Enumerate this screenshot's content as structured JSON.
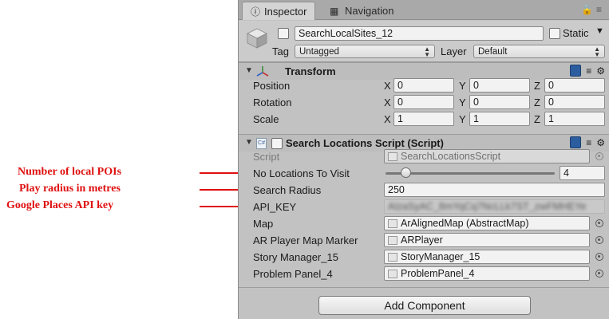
{
  "annotations": [
    {
      "label": "Number of local POIs"
    },
    {
      "label": "Play radius in metres"
    },
    {
      "label": "Google Places API key"
    }
  ],
  "tabs": {
    "inspector": "Inspector",
    "navigation": "Navigation"
  },
  "header": {
    "object_name": "SearchLocalSites_12",
    "static_label": "Static",
    "tag_label": "Tag",
    "tag_value": "Untagged",
    "layer_label": "Layer",
    "layer_value": "Default"
  },
  "transform": {
    "title": "Transform",
    "rows": [
      {
        "label": "Position",
        "x": "0",
        "y": "0",
        "z": "0"
      },
      {
        "label": "Rotation",
        "x": "0",
        "y": "0",
        "z": "0"
      },
      {
        "label": "Scale",
        "x": "1",
        "y": "1",
        "z": "1"
      }
    ],
    "axis": {
      "x": "X",
      "y": "Y",
      "z": "Z"
    }
  },
  "script_component": {
    "title": "Search Locations Script (Script)",
    "script_label": "Script",
    "script_value": "SearchLocationsScript",
    "no_locations_label": "No Locations To Visit",
    "no_locations_value": "4",
    "no_locations_fraction": 0.12,
    "search_radius_label": "Search Radius",
    "search_radius_value": "250",
    "api_key_label": "API_KEY",
    "api_key_value": "AIzaSyAC_8mYqCq7NcLLk7ST_zwFMHEYe",
    "map_label": "Map",
    "map_value": "ArAlignedMap (AbstractMap)",
    "marker_label": "AR Player Map Marker",
    "marker_value": "ARPlayer",
    "story_label": "Story Manager_15",
    "story_value": "StoryManager_15",
    "problem_label": "Problem Panel_4",
    "problem_value": "ProblemPanel_4"
  },
  "add_component": "Add Component",
  "colors": {
    "annotation": "#e01010",
    "panel": "#c2c2c2",
    "book_icon": "#2c5d9f"
  }
}
